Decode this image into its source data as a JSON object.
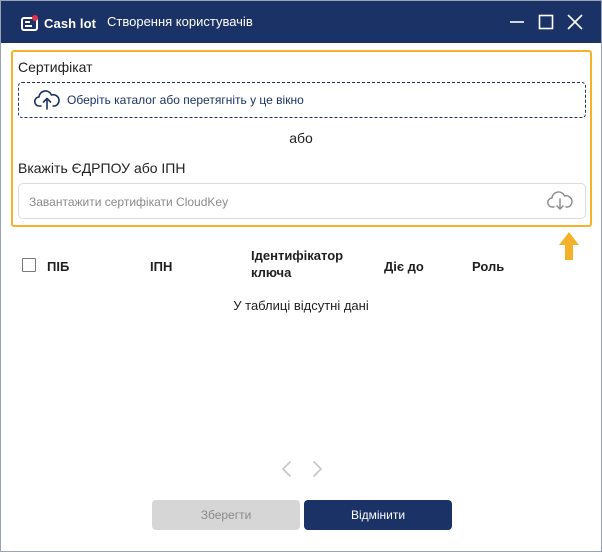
{
  "app": {
    "brand": "Cash lot",
    "window_title": "Створення користувачів",
    "accent_color": "#1b3266",
    "highlight_color": "#f5b12a"
  },
  "certificate": {
    "label": "Сертифікат",
    "dropzone_text": "Оберіть каталог або перетягніть у це вікно",
    "dropzone_icon": "cloud-upload-icon"
  },
  "or_text": "або",
  "edrpou": {
    "label": "Вкажіть ЄДРПОУ або ІПН",
    "placeholder": "Завантажити сертифікати CloudKey",
    "icon": "cloud-download-icon"
  },
  "table": {
    "columns": [
      "ПІБ",
      "ІПН",
      "Ідентифікатор ключа",
      "Діє до",
      "Роль"
    ],
    "empty_text": "У таблиці відсутні дані"
  },
  "footer": {
    "save_label": "Зберегти",
    "cancel_label": "Відмінити"
  }
}
